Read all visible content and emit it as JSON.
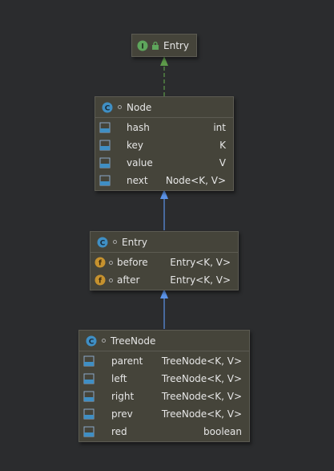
{
  "colors": {
    "background": "#2b2c2e",
    "box_fill": "#45443a",
    "class_icon": "#3f8fc4",
    "interface_icon": "#5ea65c",
    "field_icon_final": "#c6922e",
    "implements_arrow": "#5d9a4a",
    "extends_arrow": "#5b93e8"
  },
  "nodes": {
    "entry_interface": {
      "icon": "interface-icon",
      "title": "Entry"
    },
    "node": {
      "icon": "class-icon",
      "title": "Node",
      "fields": [
        {
          "name": "hash",
          "type": "int",
          "icon": "field-icon"
        },
        {
          "name": "key",
          "type": "K",
          "icon": "field-icon"
        },
        {
          "name": "value",
          "type": "V",
          "icon": "field-icon"
        },
        {
          "name": "next",
          "type": "Node<K, V>",
          "icon": "field-icon"
        }
      ]
    },
    "entry_class": {
      "icon": "class-icon",
      "title": "Entry",
      "fields": [
        {
          "name": "before",
          "type": "Entry<K, V>",
          "icon": "final-field-icon"
        },
        {
          "name": "after",
          "type": "Entry<K, V>",
          "icon": "final-field-icon"
        }
      ]
    },
    "treenode": {
      "icon": "class-icon",
      "title": "TreeNode",
      "fields": [
        {
          "name": "parent",
          "type": "TreeNode<K, V>",
          "icon": "field-icon"
        },
        {
          "name": "left",
          "type": "TreeNode<K, V>",
          "icon": "field-icon"
        },
        {
          "name": "right",
          "type": "TreeNode<K, V>",
          "icon": "field-icon"
        },
        {
          "name": "prev",
          "type": "TreeNode<K, V>",
          "icon": "field-icon"
        },
        {
          "name": "red",
          "type": "boolean",
          "icon": "field-icon"
        }
      ]
    }
  },
  "edges": [
    {
      "from": "node",
      "to": "entry_interface",
      "kind": "implements"
    },
    {
      "from": "entry_class",
      "to": "node",
      "kind": "extends"
    },
    {
      "from": "treenode",
      "to": "entry_class",
      "kind": "extends"
    }
  ]
}
